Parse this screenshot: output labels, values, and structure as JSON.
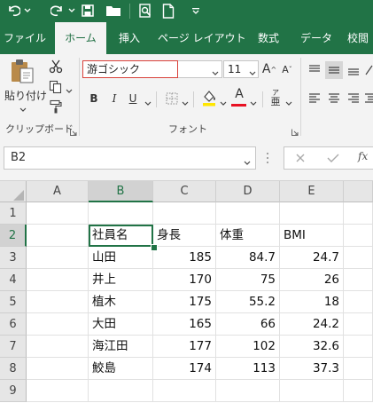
{
  "quick_access": {
    "undo_icon": "undo-icon",
    "redo_icon": "redo-icon",
    "save_icon": "save-icon",
    "open_icon": "folder-icon",
    "print_preview_icon": "print-preview-icon",
    "new_icon": "new-document-icon",
    "customize_icon": "chevron-down-icon"
  },
  "tabs": [
    {
      "label": "ファイル",
      "active": false
    },
    {
      "label": "ホーム",
      "active": true
    },
    {
      "label": "挿入",
      "active": false
    },
    {
      "label": "ページ レイアウト",
      "active": false
    },
    {
      "label": "数式",
      "active": false
    },
    {
      "label": "データ",
      "active": false
    },
    {
      "label": "校閲",
      "active": false
    }
  ],
  "ribbon": {
    "clipboard": {
      "paste_label": "貼り付け",
      "group_label": "クリップボード"
    },
    "font": {
      "font_name": "游ゴシック",
      "font_size": "11",
      "grow_label": "A",
      "shrink_label": "A",
      "bold_label": "B",
      "italic_label": "I",
      "underline_label": "U",
      "font_color_label": "A",
      "phonetic_label": "ア",
      "group_label": "フォント"
    }
  },
  "formula_bar": {
    "name_box": "B2",
    "fx_label": "fx",
    "formula": ""
  },
  "sheet": {
    "columns": [
      "A",
      "B",
      "C",
      "D",
      "E"
    ],
    "rows": [
      "1",
      "2",
      "3",
      "4",
      "5",
      "6",
      "7",
      "8",
      "9"
    ],
    "selected_cell": "B2",
    "header_row": [
      "社員名",
      "身長",
      "体重",
      "BMI"
    ],
    "data_rows": [
      [
        "山田",
        "185",
        "84.7",
        "24.7"
      ],
      [
        "井上",
        "170",
        "75",
        "26"
      ],
      [
        "植木",
        "175",
        "55.2",
        "18"
      ],
      [
        "大田",
        "165",
        "66",
        "24.2"
      ],
      [
        "海江田",
        "177",
        "102",
        "32.6"
      ],
      [
        "鮫島",
        "174",
        "113",
        "37.3"
      ]
    ]
  },
  "colors": {
    "accent": "#217346",
    "highlight_yellow": "#ffe600",
    "font_red": "#e81123",
    "font_box_border": "#d9413a"
  }
}
